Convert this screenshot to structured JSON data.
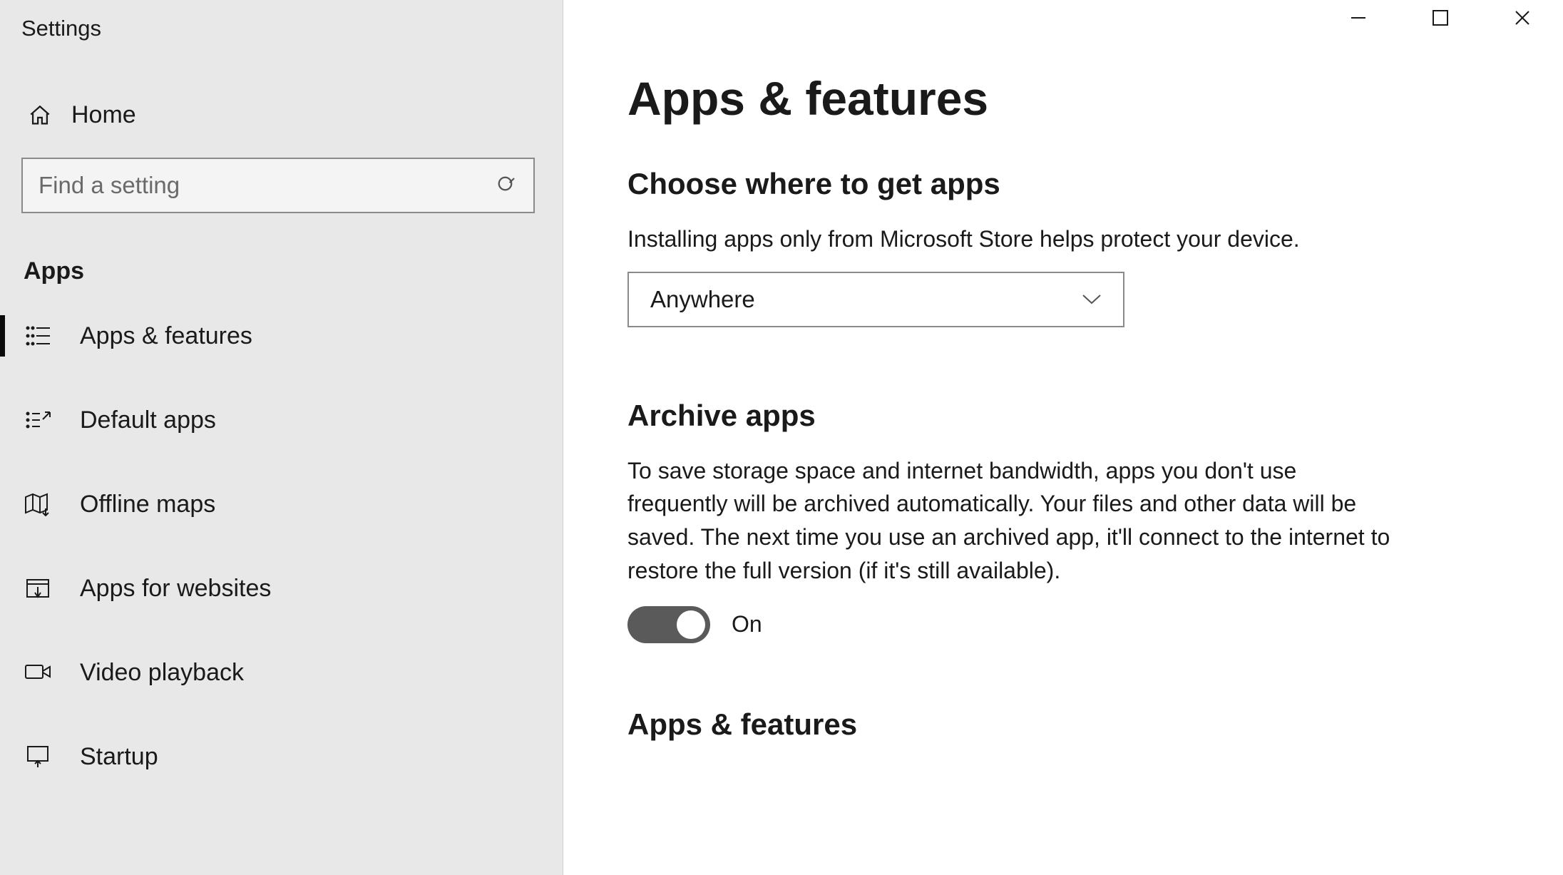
{
  "window": {
    "title": "Settings"
  },
  "sidebar": {
    "home_label": "Home",
    "search_placeholder": "Find a setting",
    "section_label": "Apps",
    "items": [
      {
        "label": "Apps & features",
        "active": true
      },
      {
        "label": "Default apps"
      },
      {
        "label": "Offline maps"
      },
      {
        "label": "Apps for websites"
      },
      {
        "label": "Video playback"
      },
      {
        "label": "Startup"
      }
    ]
  },
  "main": {
    "page_title": "Apps & features",
    "section1": {
      "heading": "Choose where to get apps",
      "description": "Installing apps only from Microsoft Store helps protect your device.",
      "dropdown_value": "Anywhere"
    },
    "section2": {
      "heading": "Archive apps",
      "description": "To save storage space and internet bandwidth, apps you don't use frequently will be archived automatically. Your files and other data will be saved. The next time you use an archived app, it'll connect to the internet to restore the full version (if it's still available).",
      "toggle_state": "On"
    },
    "section3": {
      "heading": "Apps & features"
    }
  }
}
